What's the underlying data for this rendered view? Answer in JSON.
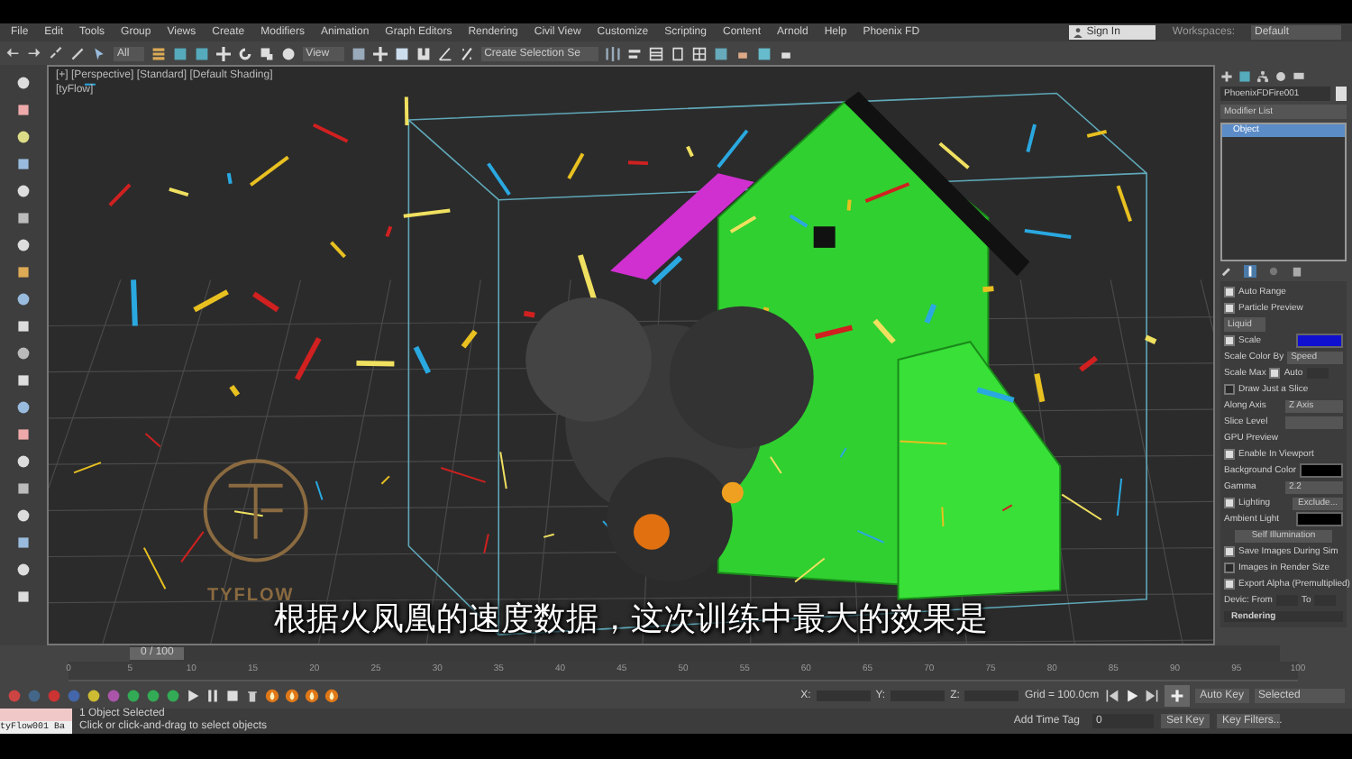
{
  "menu": [
    "File",
    "Edit",
    "Tools",
    "Group",
    "Views",
    "Create",
    "Modifiers",
    "Animation",
    "Graph Editors",
    "Rendering",
    "Civil View",
    "Customize",
    "Scripting",
    "Content",
    "Arnold",
    "Help",
    "Phoenix FD"
  ],
  "account": {
    "sign_in": "Sign In",
    "workspaces_label": "Workspaces:",
    "workspace": "Default"
  },
  "toolbar": {
    "selection_filter": "All",
    "reference_coord": "View",
    "selection_set": "Create Selection Se"
  },
  "viewport": {
    "label": "[+] [Perspective] [Standard] [Default Shading]",
    "sublabel": "[tyFlow]",
    "logo_text": "TYFLOW",
    "subtitle": "根据火凤凰的速度数据，这次训练中最大的效果是"
  },
  "command_panel": {
    "object_name": "PhoenixFDFire001",
    "modifier_list": "Modifier List",
    "stack": [
      {
        "label": "Object",
        "selected": true
      }
    ],
    "rows": [
      {
        "kind": "check",
        "label": "Auto Range",
        "checked": true
      },
      {
        "kind": "check",
        "label": "Particle Preview",
        "checked": true
      },
      {
        "kind": "dropdown",
        "value": "Liquid"
      },
      {
        "kind": "color",
        "label": "Scale",
        "checked": true,
        "color": "#1010d0"
      },
      {
        "kind": "labeled",
        "label": "Scale Color By",
        "value": "Speed"
      },
      {
        "kind": "labeled_check",
        "label": "Scale Max",
        "check_label": "Auto",
        "checked": true
      },
      {
        "kind": "check",
        "label": "Draw Just a Slice",
        "checked": false
      },
      {
        "kind": "labeled",
        "label": "Along Axis",
        "value": "Z Axis"
      },
      {
        "kind": "labeled",
        "label": "Slice Level"
      },
      {
        "kind": "header",
        "label": "GPU Preview"
      },
      {
        "kind": "check",
        "label": "Enable In Viewport",
        "checked": true
      },
      {
        "kind": "color",
        "label": "Background Color",
        "color": "#000000"
      },
      {
        "kind": "labeled",
        "label": "Gamma",
        "value": "2.2"
      },
      {
        "kind": "check",
        "label": "Lighting",
        "checked": true,
        "value": "Exclude..."
      },
      {
        "kind": "color",
        "label": "Ambient Light",
        "color": "#000000"
      },
      {
        "kind": "button",
        "label": "Self Illumination"
      },
      {
        "kind": "check",
        "label": "Save Images During Sim",
        "checked": true
      },
      {
        "kind": "check",
        "label": "Images in Render Size",
        "checked": false
      },
      {
        "kind": "check",
        "label": "Export Alpha (Premultiplied)",
        "checked": true
      },
      {
        "kind": "range",
        "label": "Devic: From",
        "to_label": "To"
      },
      {
        "kind": "rollout",
        "label": "Rendering"
      }
    ]
  },
  "timeline": {
    "frame": "0 / 100",
    "level": 0,
    "ticks": [
      "0",
      "5",
      "10",
      "15",
      "20",
      "25",
      "30",
      "35",
      "40",
      "45",
      "50",
      "55",
      "60",
      "65",
      "70",
      "75",
      "80",
      "85",
      "90",
      "95",
      "100"
    ]
  },
  "status": {
    "listener": "tyFlow001 Ba",
    "selection": "1 Object Selected",
    "prompt": "Click or click-and-drag to select objects",
    "x_label": "X:",
    "y_label": "Y:",
    "z_label": "Z:",
    "grid": "Grid = 100.0cm",
    "add_time_tag": "Add Time Tag",
    "auto_key": "Auto Key",
    "key_mode": "Selected",
    "set_key": "Set Key",
    "key_filters": "Key Filters...",
    "current_frame": "0"
  }
}
